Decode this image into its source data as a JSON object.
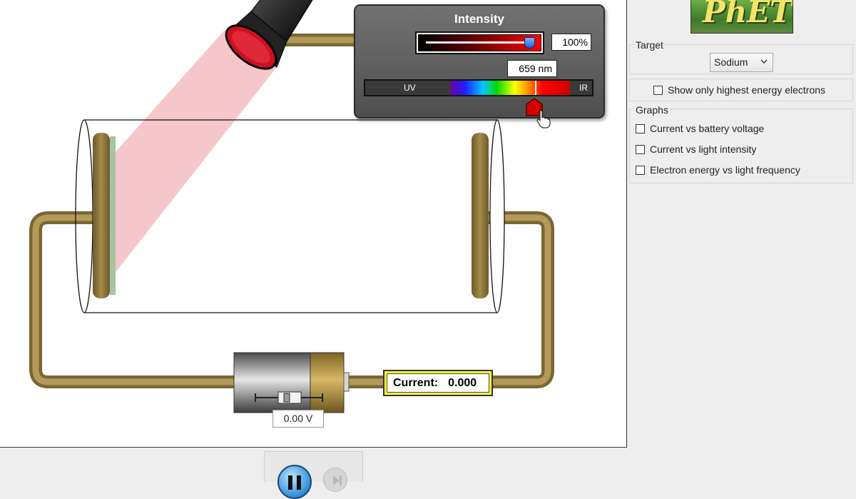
{
  "light_panel": {
    "intensity_title": "Intensity",
    "intensity_value": "100%",
    "intensity_level": 1.0,
    "wavelength_value": "659 nm",
    "uv_label": "UV",
    "ir_label": "IR"
  },
  "circuit": {
    "current_label": "Current:",
    "current_value": "0.000",
    "voltage_value": "0.00 V"
  },
  "clock": {
    "pause_icon": "pause-icon",
    "step_icon": "step-icon"
  },
  "control_panel": {
    "logo_text": "PhET",
    "target_title": "Target",
    "target_selected": "Sodium",
    "highest_energy_label": "Show only highest energy electrons",
    "highest_energy_checked": false,
    "graphs_title": "Graphs",
    "graphs": [
      {
        "label": "Current vs battery voltage",
        "checked": false
      },
      {
        "label": "Current vs light intensity",
        "checked": false
      },
      {
        "label": "Electron energy vs light frequency",
        "checked": false
      }
    ]
  },
  "colors": {
    "wire": "#9b8345",
    "beam": "#f4c4c8",
    "current_frame": "#ffff33",
    "wavelength_thumb": "#d40000"
  }
}
